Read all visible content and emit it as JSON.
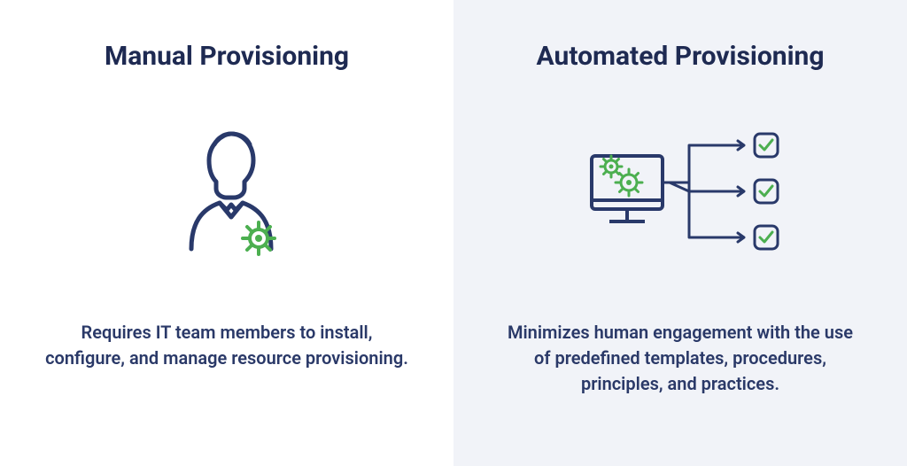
{
  "panels": {
    "left": {
      "title": "Manual Provisioning",
      "description": "Requires IT team members to install, configure, and manage resource provisioning.",
      "icon_name": "person-gear-icon"
    },
    "right": {
      "title": "Automated Provisioning",
      "description": "Minimizes human engagement with the use of predefined templates, procedures, principles, and practices.",
      "icon_name": "computer-workflow-icon"
    }
  },
  "colors": {
    "navy": "#29396a",
    "green": "#4caf50",
    "background_right": "#f1f3f8"
  }
}
